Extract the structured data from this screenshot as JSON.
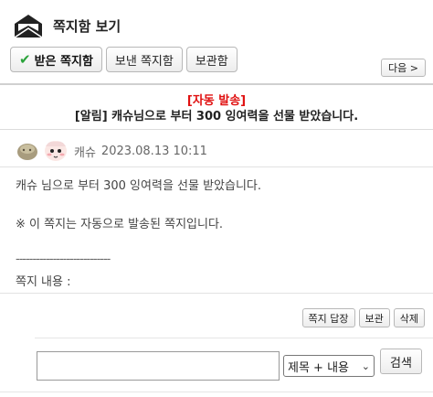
{
  "header": {
    "title": "쪽지함 보기",
    "icon": "envelope-icon"
  },
  "tabs": [
    {
      "label": "받은 쪽지함",
      "active": true,
      "icon": "check-icon"
    },
    {
      "label": "보낸 쪽지함",
      "active": false
    },
    {
      "label": "보관함",
      "active": false
    }
  ],
  "nav": {
    "next_label": "다음 >"
  },
  "message": {
    "auto_tag": "[자동 발송]",
    "title": "[알림] 캐슈님으로 부터 300 잉여력을 선물 받았습니다.",
    "sender_name": "캐슈",
    "sent_at": "2023.08.13 10:11",
    "body_line1": "캐슈 님으로 부터 300 잉여력을 선물 받았습니다.",
    "body_line2": "※ 이 쪽지는 자동으로 발송된 쪽지입니다.",
    "separator": "----------------------------",
    "reply_label": "쪽지 내용 :"
  },
  "actions": {
    "reply": "쪽지 답장",
    "archive": "보관",
    "delete": "삭제"
  },
  "search": {
    "value": "",
    "select_value": "제목 + 내용",
    "button": "검색"
  }
}
